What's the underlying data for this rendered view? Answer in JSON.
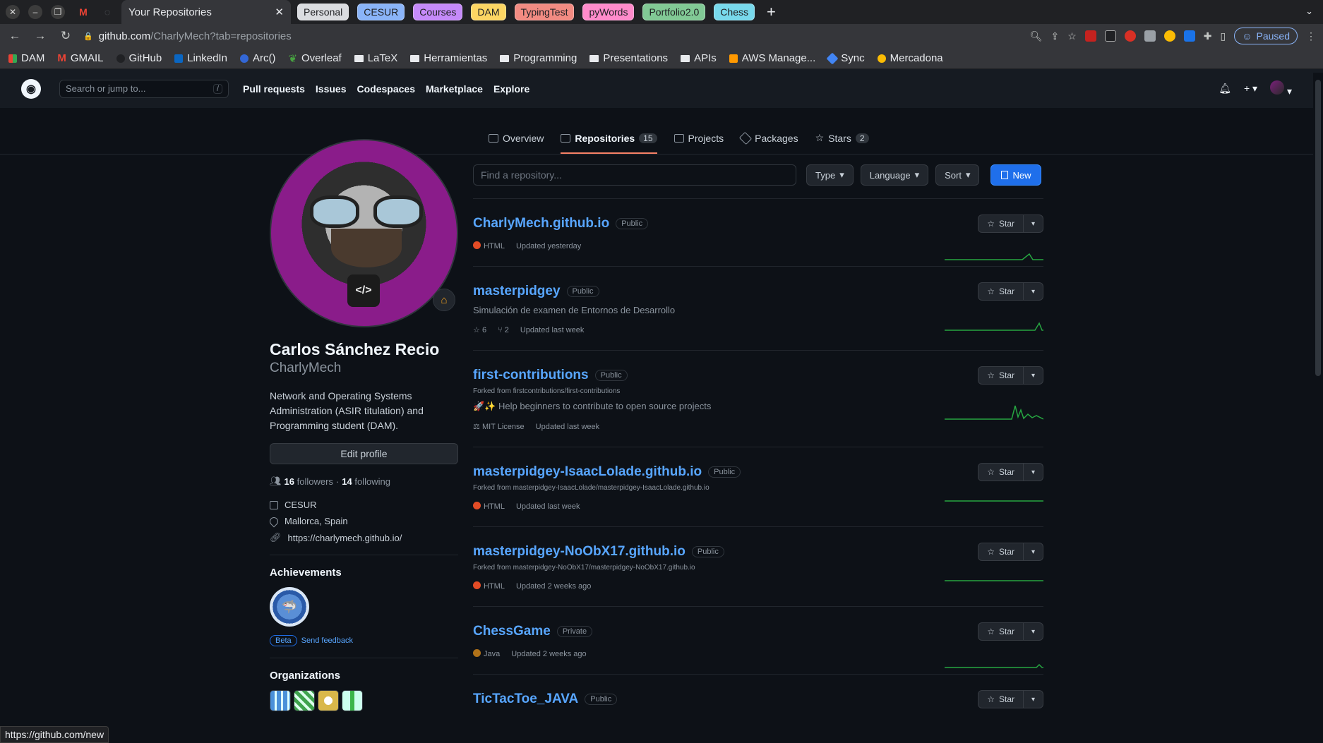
{
  "browser": {
    "active_tab": "Your Repositories",
    "tab_groups": [
      {
        "label": "Personal",
        "color": "#dadce0"
      },
      {
        "label": "CESUR",
        "color": "#8ab4f8"
      },
      {
        "label": "Courses",
        "color": "#c58af9"
      },
      {
        "label": "DAM",
        "color": "#fdd663"
      },
      {
        "label": "TypingTest",
        "color": "#f28b82"
      },
      {
        "label": "pyWords",
        "color": "#ff8bcb"
      },
      {
        "label": "Portfolio2.0",
        "color": "#81c995"
      },
      {
        "label": "Chess",
        "color": "#78d9ec"
      }
    ],
    "url_host": "github.com",
    "url_path": "/CharlyMech?tab=repositories",
    "profile_status": "Paused",
    "bookmarks": [
      "DAM",
      "GMAIL",
      "GitHub",
      "LinkedIn",
      "Arc()",
      "Overleaf",
      "LaTeX",
      "Herramientas",
      "Programming",
      "Presentations",
      "APIs",
      "AWS Manage...",
      "Sync",
      "Mercadona"
    ],
    "status_url": "https://github.com/new"
  },
  "header": {
    "search_placeholder": "Search or jump to...",
    "search_key": "/",
    "nav": [
      "Pull requests",
      "Issues",
      "Codespaces",
      "Marketplace",
      "Explore"
    ]
  },
  "profile_nav": {
    "overview": "Overview",
    "repositories": "Repositories",
    "repositories_count": "15",
    "projects": "Projects",
    "packages": "Packages",
    "stars": "Stars",
    "stars_count": "2"
  },
  "profile": {
    "name": "Carlos Sánchez Recio",
    "login": "CharlyMech",
    "bio": "Network and Operating Systems Administration (ASIR titulation) and Programming student (DAM).",
    "edit_label": "Edit profile",
    "followers_count": "16",
    "followers_label": "followers",
    "following_count": "14",
    "following_label": "following",
    "company": "CESUR",
    "location": "Mallorca, Spain",
    "website": "https://charlymech.github.io/",
    "achievements_title": "Achievements",
    "beta_label": "Beta",
    "feedback_label": "Send feedback",
    "orgs_title": "Organizations"
  },
  "filters": {
    "find_placeholder": "Find a repository...",
    "type_label": "Type",
    "language_label": "Language",
    "sort_label": "Sort",
    "new_label": "New"
  },
  "repos": [
    {
      "name": "CharlyMech.github.io",
      "visibility": "Public",
      "language": "HTML",
      "lang_color": "#e34c26",
      "updated": "Updated yesterday"
    },
    {
      "name": "masterpidgey",
      "visibility": "Public",
      "description": "Simulación de examen de Entornos de Desarrollo",
      "stars": "6",
      "forks": "2",
      "updated": "Updated last week"
    },
    {
      "name": "first-contributions",
      "visibility": "Public",
      "forked_from": "Forked from firstcontributions/first-contributions",
      "description": "🚀✨ Help beginners to contribute to open source projects",
      "license": "MIT License",
      "updated": "Updated last week"
    },
    {
      "name": "masterpidgey-IsaacLolade.github.io",
      "visibility": "Public",
      "forked_from": "Forked from masterpidgey-IsaacLolade/masterpidgey-IsaacLolade.github.io",
      "language": "HTML",
      "lang_color": "#e34c26",
      "updated": "Updated last week"
    },
    {
      "name": "masterpidgey-NoObX17.github.io",
      "visibility": "Public",
      "forked_from": "Forked from masterpidgey-NoObX17/masterpidgey-NoObX17.github.io",
      "language": "HTML",
      "lang_color": "#e34c26",
      "updated": "Updated 2 weeks ago"
    },
    {
      "name": "ChessGame",
      "visibility": "Private",
      "language": "Java",
      "lang_color": "#b07219",
      "updated": "Updated 2 weeks ago"
    },
    {
      "name": "TicTacToe_JAVA",
      "visibility": "Public"
    }
  ],
  "star_label": "Star"
}
